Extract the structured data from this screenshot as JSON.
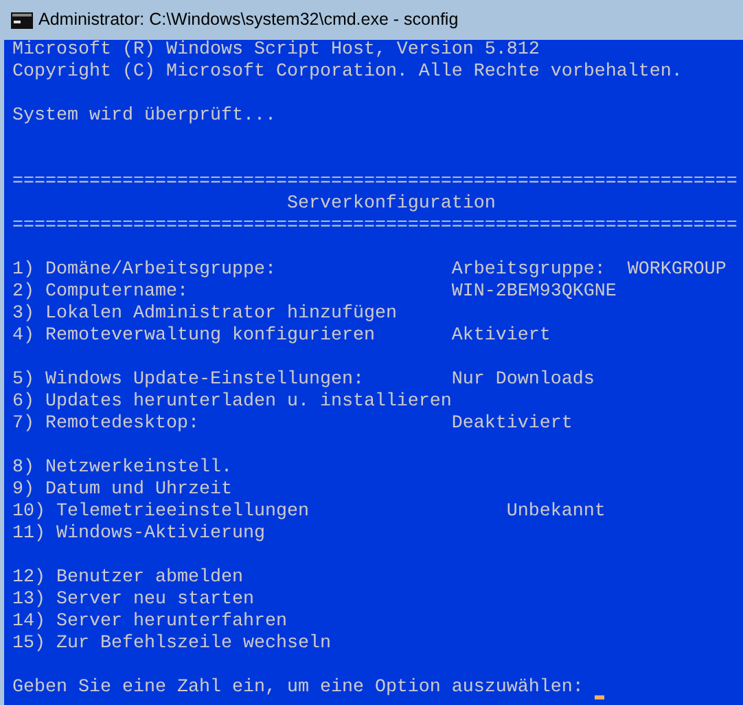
{
  "window": {
    "title": "Administrator: C:\\Windows\\system32\\cmd.exe - sconfig"
  },
  "console": {
    "header": [
      "Microsoft (R) Windows Script Host, Version 5.812",
      "Copyright (C) Microsoft Corporation. Alle Rechte vorbehalten."
    ],
    "status": "System wird überprüft...",
    "rules": [
      "==================================================================",
      "=================================================================="
    ],
    "heading": "Serverkonfiguration",
    "groups": [
      [
        {
          "label": "1) Domäne/Arbeitsgruppe:",
          "value": "Arbeitsgruppe:  WORKGROUP"
        },
        {
          "label": "2) Computername:",
          "value": "WIN-2BEM93QKGNE"
        },
        {
          "label": "3) Lokalen Administrator hinzufügen"
        },
        {
          "label": "4) Remoteverwaltung konfigurieren",
          "value": "Aktiviert"
        }
      ],
      [
        {
          "label": "5) Windows Update-Einstellungen:",
          "value": "Nur Downloads"
        },
        {
          "label": "6) Updates herunterladen u. installieren"
        },
        {
          "label": "7) Remotedesktop:",
          "value": "Deaktiviert"
        }
      ],
      [
        {
          "label": "8) Netzwerkeinstell."
        },
        {
          "label": "9) Datum und Uhrzeit"
        },
        {
          "label": "10) Telemetrieeinstellungen",
          "value": "Unbekannt"
        },
        {
          "label": "11) Windows-Aktivierung"
        }
      ],
      [
        {
          "label": "12) Benutzer abmelden"
        },
        {
          "label": "13) Server neu starten"
        },
        {
          "label": "14) Server herunterfahren"
        },
        {
          "label": "15) Zur Befehlszeile wechseln"
        }
      ]
    ],
    "prompt": "Geben Sie eine Zahl ein, um eine Option auszuwählen:"
  }
}
